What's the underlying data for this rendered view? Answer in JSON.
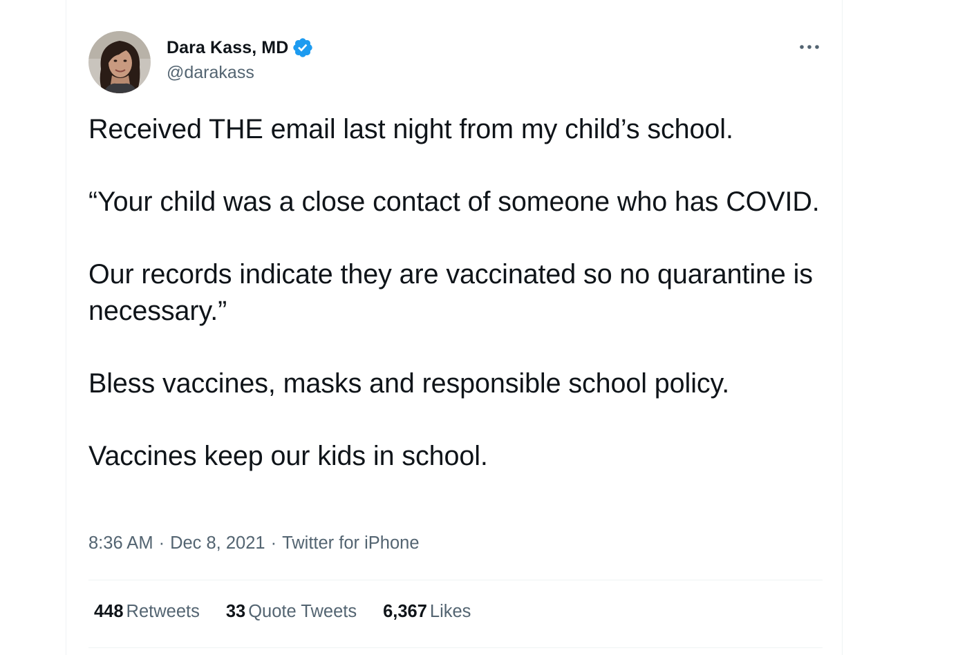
{
  "author": {
    "display_name": "Dara Kass, MD",
    "handle": "@darakass",
    "verified": true,
    "avatar_icon": "profile-photo"
  },
  "tweet": {
    "text": "Received THE email last night from my child’s school.\n\n“Your child was a close contact of someone who has COVID.\n\nOur records indicate they are vaccinated so no quarantine is necessary.”\n\nBless vaccines, masks and responsible school policy.\n\nVaccines keep our kids in school.",
    "time": "8:36 AM",
    "date": "Dec 8, 2021",
    "source": "Twitter for iPhone",
    "separator": "·"
  },
  "stats": {
    "retweets_count": "448",
    "retweets_label": "Retweets",
    "quote_tweets_count": "33",
    "quote_tweets_label": "Quote Tweets",
    "likes_count": "6,367",
    "likes_label": "Likes"
  },
  "colors": {
    "text_primary": "#0f1419",
    "text_secondary": "#536471",
    "verified_blue": "#1d9bf0",
    "divider": "#eff3f4"
  },
  "icons": {
    "verified": "verified-badge-icon",
    "more": "more-horizontal-icon"
  }
}
